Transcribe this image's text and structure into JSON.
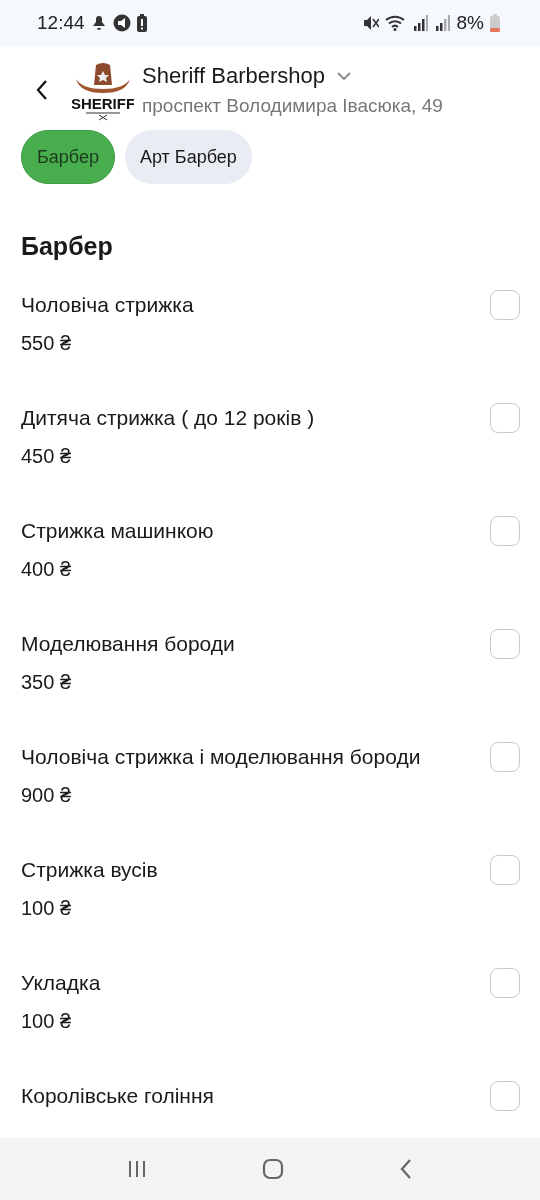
{
  "status_bar": {
    "time": "12:44",
    "battery": "8%"
  },
  "header": {
    "title": "Sheriff Barbershop",
    "address": "проспект Володимира Івасюка, 49",
    "logo_text": "SHERIFF"
  },
  "categories": [
    {
      "label": "Барбер",
      "selected": true
    },
    {
      "label": "Арт Барбер",
      "selected": false
    }
  ],
  "section": {
    "title": "Барбер",
    "services": [
      {
        "name": "Чоловіча стрижка",
        "price": "550 ₴",
        "checked": false
      },
      {
        "name": "Дитяча стрижка ( до 12 років )",
        "price": "450 ₴",
        "checked": false
      },
      {
        "name": "Стрижка машинкою",
        "price": "400 ₴",
        "checked": false
      },
      {
        "name": "Моделювання бороди",
        "price": "350 ₴",
        "checked": false
      },
      {
        "name": "Чоловіча стрижка і моделювання бороди",
        "price": "900 ₴",
        "checked": false
      },
      {
        "name": "Стрижка вусів",
        "price": "100 ₴",
        "checked": false
      },
      {
        "name": "Укладка",
        "price": "100 ₴",
        "checked": false
      },
      {
        "name": "Королівське гоління",
        "checked": false
      }
    ]
  }
}
